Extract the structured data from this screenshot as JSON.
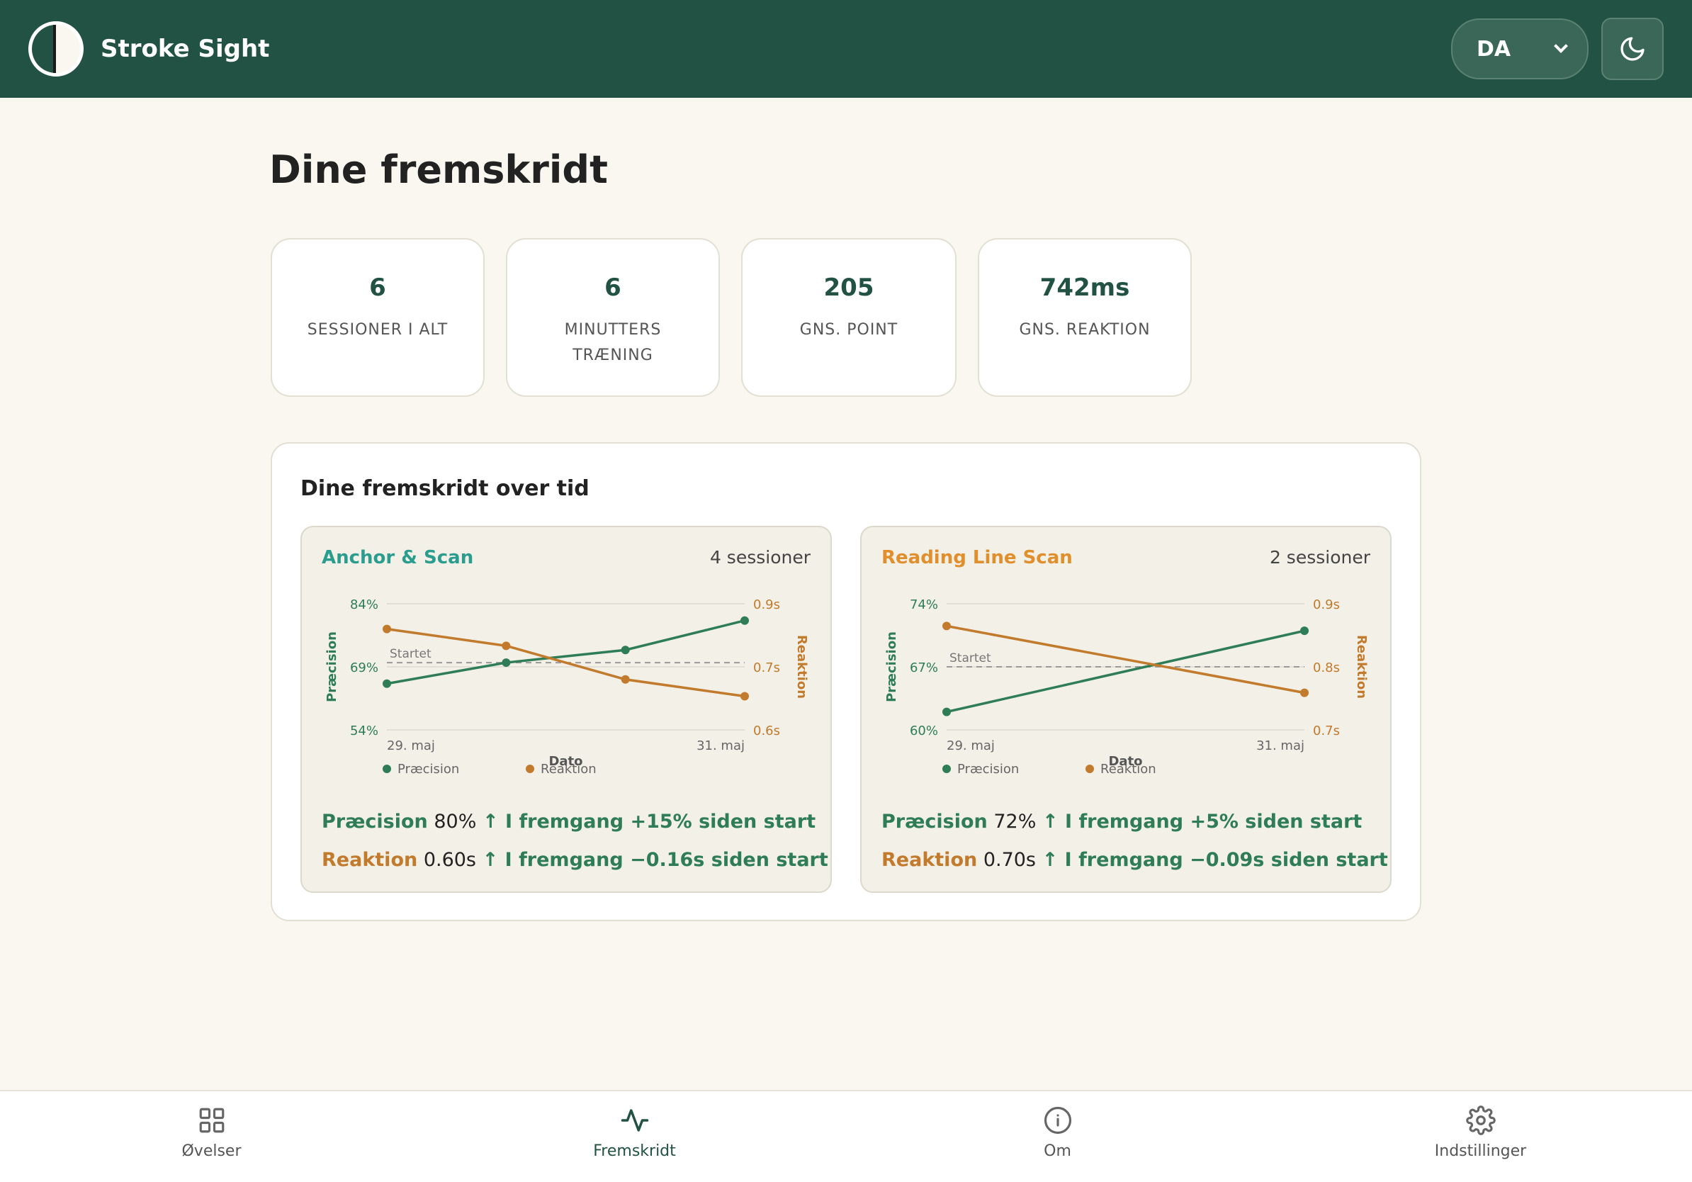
{
  "header": {
    "app_title": "Stroke Sight",
    "language": "DA",
    "icons": {
      "logo": "half-circle-logo-icon",
      "theme": "moon-icon",
      "dropdown": "chevron-down-icon"
    }
  },
  "page": {
    "title": "Dine fremskridt"
  },
  "stats": [
    {
      "value": "6",
      "label": "SESSIONER I ALT"
    },
    {
      "value": "6",
      "label": "MINUTTERS TRÆNING"
    },
    {
      "value": "205",
      "label": "GNS. POINT"
    },
    {
      "value": "742ms",
      "label": "GNS. REAKTION"
    }
  ],
  "progress": {
    "title": "Dine fremskridt over tid",
    "exercises": [
      {
        "name": "Anchor & Scan",
        "sessions": "4 sessioner",
        "color": "#2a9d8f",
        "summary": {
          "precision_label": "Præcision",
          "precision_value": "80%",
          "precision_trend": "↑ I fremgang +15% siden start",
          "reaction_label": "Reaktion",
          "reaction_value": "0.60s",
          "reaction_trend": "↑ I fremgang −0.16s siden start"
        }
      },
      {
        "name": "Reading Line Scan",
        "sessions": "2 sessioner",
        "color": "#e08f2c",
        "summary": {
          "precision_label": "Præcision",
          "precision_value": "72%",
          "precision_trend": "↑ I fremgang +5% siden start",
          "reaction_label": "Reaktion",
          "reaction_value": "0.70s",
          "reaction_trend": "↑ I fremgang −0.09s siden start"
        }
      }
    ]
  },
  "chart_data": [
    {
      "type": "line",
      "xlabel": "Dato",
      "x_tick_labels": [
        "29. maj",
        "31. maj"
      ],
      "y_left_label": "Præcision",
      "y_left_ticks": [
        "84%",
        "69%",
        "54%"
      ],
      "y_left_range": [
        54,
        84
      ],
      "y_right_label": "Reaktion",
      "y_right_ticks": [
        "0.9s",
        "0.7s",
        "0.6s"
      ],
      "y_right_range": [
        0.55,
        0.85
      ],
      "baseline_label": "Startet",
      "legend": [
        "Præcision",
        "Reaktion"
      ],
      "grid": true,
      "series": [
        {
          "name": "Præcision",
          "axis": "left",
          "color": "#2e7d57",
          "values": [
            65,
            70,
            73,
            80
          ]
        },
        {
          "name": "Reaktion",
          "axis": "right",
          "color": "#c27a2c",
          "values": [
            0.79,
            0.75,
            0.67,
            0.63
          ]
        }
      ],
      "baseline_value_left": 70
    },
    {
      "type": "line",
      "xlabel": "Dato",
      "x_tick_labels": [
        "29. maj",
        "31. maj"
      ],
      "y_left_label": "Præcision",
      "y_left_ticks": [
        "74%",
        "67%",
        "60%"
      ],
      "y_left_range": [
        60,
        74
      ],
      "y_right_label": "Reaktion",
      "y_right_ticks": [
        "0.9s",
        "0.8s",
        "0.7s"
      ],
      "y_right_range": [
        0.65,
        0.82
      ],
      "baseline_label": "Startet",
      "legend": [
        "Præcision",
        "Reaktion"
      ],
      "grid": true,
      "series": [
        {
          "name": "Præcision",
          "axis": "left",
          "color": "#2e7d57",
          "values": [
            62,
            71
          ]
        },
        {
          "name": "Reaktion",
          "axis": "right",
          "color": "#c27a2c",
          "values": [
            0.79,
            0.7
          ]
        }
      ],
      "baseline_value_left": 67
    }
  ],
  "bottom_nav": [
    {
      "label": "Øvelser",
      "icon": "grid-icon",
      "active": false
    },
    {
      "label": "Fremskridt",
      "icon": "activity-icon",
      "active": true
    },
    {
      "label": "Om",
      "icon": "info-icon",
      "active": false
    },
    {
      "label": "Indstillinger",
      "icon": "gear-icon",
      "active": false
    }
  ]
}
